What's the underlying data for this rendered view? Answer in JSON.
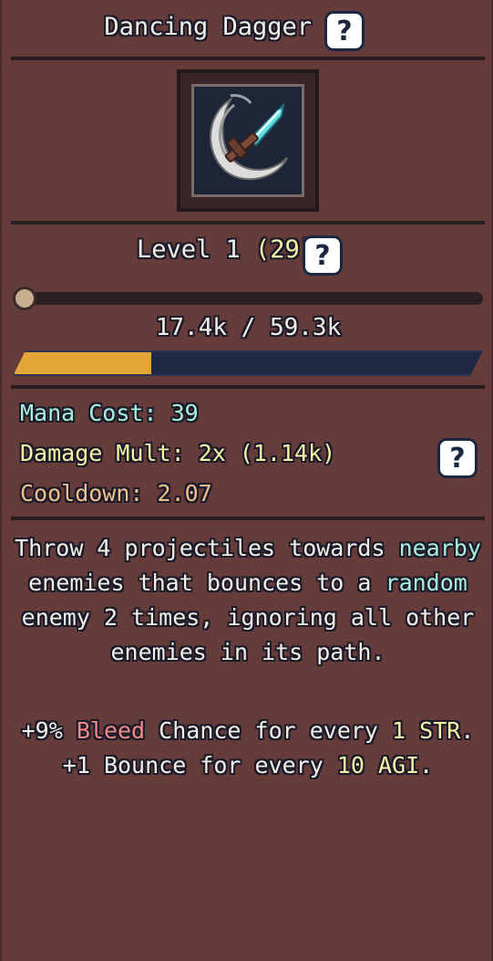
{
  "skill": {
    "name": "Dancing Dagger",
    "icon": "dancing-dagger-skill-icon"
  },
  "level": {
    "label": "Level 1",
    "total": "(29)",
    "slider_fraction": 0.0
  },
  "xp": {
    "text": "17.4k / 59.3k",
    "fraction": 0.293
  },
  "stats": {
    "mana_label": "Mana Cost:",
    "mana_value": "39",
    "damage_label": "Damage Mult:",
    "damage_value": "2x (1.14k)",
    "cooldown_label": "Cooldown:",
    "cooldown_value": "2.07"
  },
  "description": {
    "l1a": "Throw 4 projectiles towards ",
    "l1b": "nearby",
    "l2a": "enemies that bounces to a ",
    "l2b": "random",
    "l3": "enemy 2 times, ignoring all other",
    "l4": "enemies in its path.",
    "b1a": "+9% ",
    "b1b": "Bleed",
    "b1c": " Chance for every ",
    "b1d": "1 STR",
    "b1e": ".",
    "b2a": "+1 Bounce for every ",
    "b2b": "10 AGI",
    "b2c": "."
  },
  "help_icon_glyph": "?",
  "colors": {
    "panel_bg": "#663c3b",
    "xp_fill": "#e5a43a",
    "xp_empty": "#1e2a45",
    "mana_text": "#a9f0dc",
    "damage_text": "#f6f2a6",
    "cooldown_text": "#f2c08e",
    "bleed_text": "#f28a8a"
  }
}
